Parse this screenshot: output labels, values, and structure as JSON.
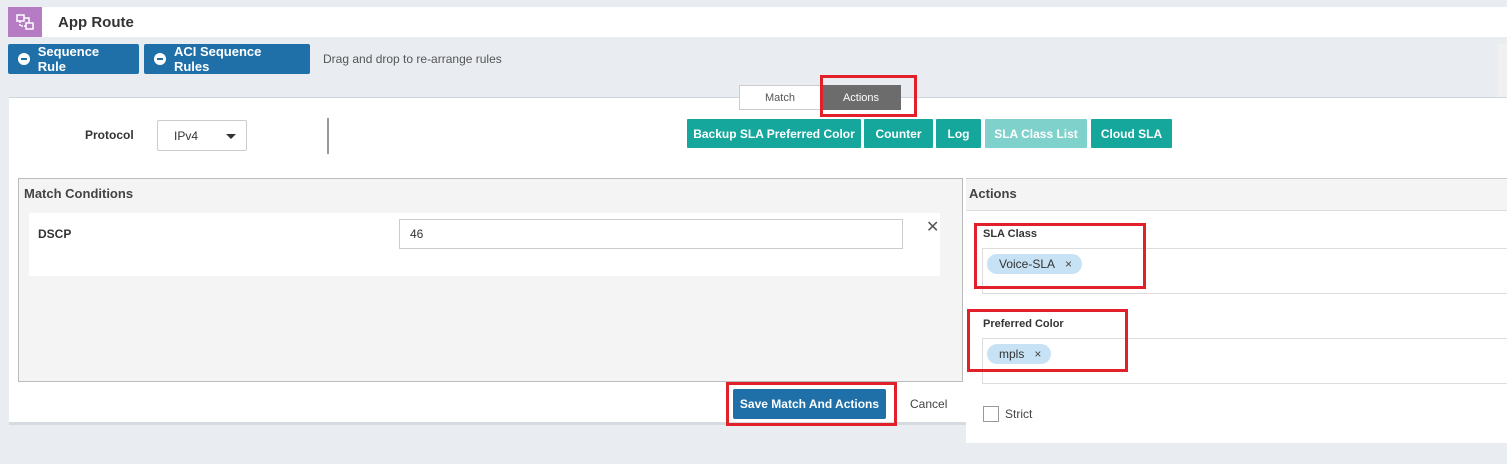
{
  "app": {
    "title": "App Route",
    "icon": "app-route-icon"
  },
  "toolbar": {
    "sequence_rule_label": "Sequence Rule",
    "aci_sequence_rules_label": "ACI Sequence Rules",
    "hint": "Drag and drop to re-arrange rules"
  },
  "tabs": {
    "match_label": "Match",
    "actions_label": "Actions",
    "active": "Actions"
  },
  "protocol": {
    "label": "Protocol",
    "value": "IPv4"
  },
  "action_buttons": [
    {
      "label": "Backup SLA Preferred Color",
      "disabled": false
    },
    {
      "label": "Counter",
      "disabled": false
    },
    {
      "label": "Log",
      "disabled": false
    },
    {
      "label": "SLA Class List",
      "disabled": true
    },
    {
      "label": "Cloud SLA",
      "disabled": false
    }
  ],
  "match_conditions": {
    "header": "Match Conditions",
    "dscp_label": "DSCP",
    "dscp_value": "46"
  },
  "actions": {
    "header": "Actions",
    "sla_class_label": "SLA Class",
    "sla_class_tag": "Voice-SLA",
    "preferred_color_label": "Preferred Color",
    "preferred_color_tag": "mpls",
    "strict_label": "Strict",
    "strict_checked": false
  },
  "footer": {
    "save_label": "Save Match And Actions",
    "cancel_label": "Cancel"
  },
  "colors": {
    "primary_blue": "#1f6fa8",
    "teal": "#15a69c",
    "teal_disabled": "#7fd1cb",
    "highlight_red": "#e2202a",
    "tag_blue": "#c7e2f4",
    "app_icon_purple": "#b57cc4"
  }
}
